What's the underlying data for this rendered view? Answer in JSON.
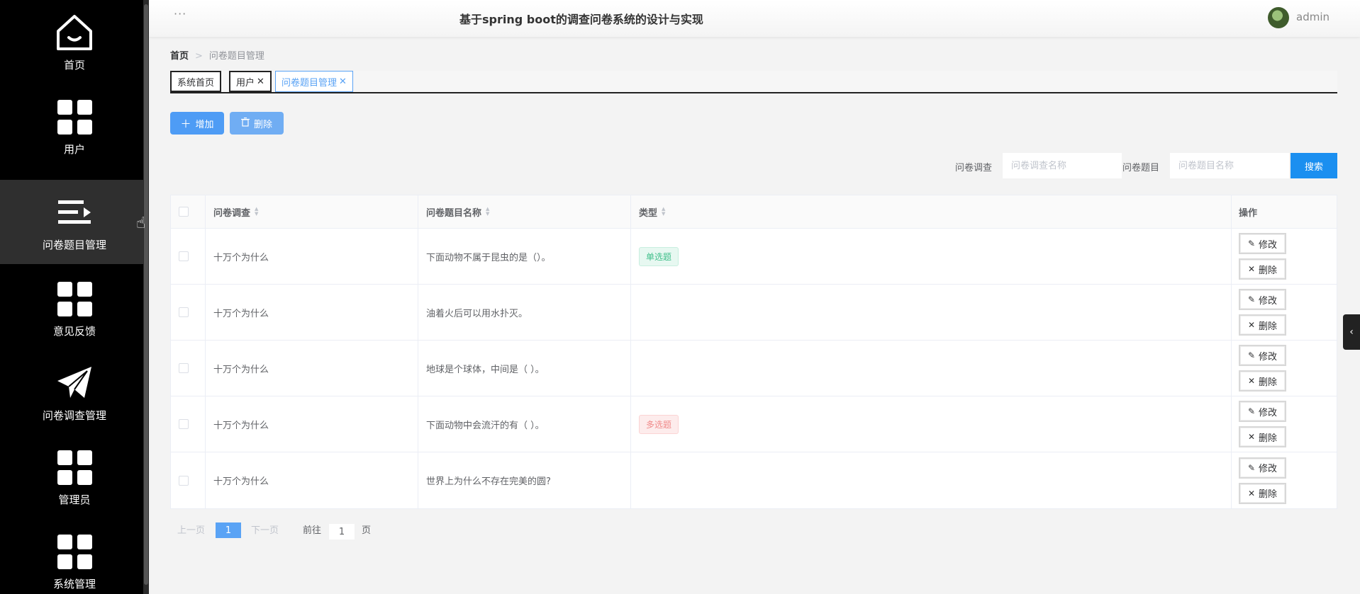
{
  "header": {
    "menu_dots": "···",
    "title": "基于spring boot的调查问卷系统的设计与实现",
    "user": "admin"
  },
  "sidebar": {
    "items": [
      {
        "label": "首页",
        "icon": "home-icon"
      },
      {
        "label": "用户",
        "icon": "grid-icon"
      },
      {
        "label": "问卷题目管理",
        "icon": "list-icon"
      },
      {
        "label": "意见反馈",
        "icon": "grid-icon"
      },
      {
        "label": "问卷调查管理",
        "icon": "paper-plane-icon"
      },
      {
        "label": "管理员",
        "icon": "grid-icon"
      },
      {
        "label": "系统管理",
        "icon": "grid-icon"
      }
    ]
  },
  "breadcrumb": {
    "home": "首页",
    "separator": ">",
    "current": "问卷题目管理"
  },
  "tabs": [
    {
      "label": "系统首页"
    },
    {
      "label": "用户",
      "close": "✕"
    },
    {
      "label": "问卷题目管理",
      "close": "✕"
    }
  ],
  "toolbar": {
    "add_label": "增加",
    "delete_label": "删除"
  },
  "search": {
    "survey_label": "问卷调查",
    "survey_placeholder": "问卷调查名称",
    "question_label": "问卷题目",
    "question_placeholder": "问卷题目名称",
    "search_label": "搜索"
  },
  "table": {
    "headers": [
      "问卷调查",
      "问卷题目名称",
      "类型",
      "操作"
    ],
    "rows": [
      {
        "survey": "十万个为什么",
        "question": "下面动物不属于昆虫的是（）。",
        "type": "单选题"
      },
      {
        "survey": "十万个为什么",
        "question": "油着火后可以用水扑灭。",
        "type": ""
      },
      {
        "survey": "十万个为什么",
        "question": "地球是个球体，中间是（ ）。",
        "type": ""
      },
      {
        "survey": "十万个为什么",
        "question": "下面动物中会流汗的有（ ）。",
        "type": "多选题"
      },
      {
        "survey": "十万个为什么",
        "question": "世界上为什么不存在完美的圆?",
        "type": ""
      }
    ],
    "edit_label": "修改",
    "delete_label": "删除"
  },
  "pagination": {
    "prev": "上一页",
    "current_page": "1",
    "next": "下一页",
    "goto_prefix": "前往",
    "goto_value": "1",
    "goto_suffix": "页"
  },
  "colors": {
    "primary": "#4e9cf5",
    "search": "#1b8ff0",
    "sidebar": "#000000"
  }
}
